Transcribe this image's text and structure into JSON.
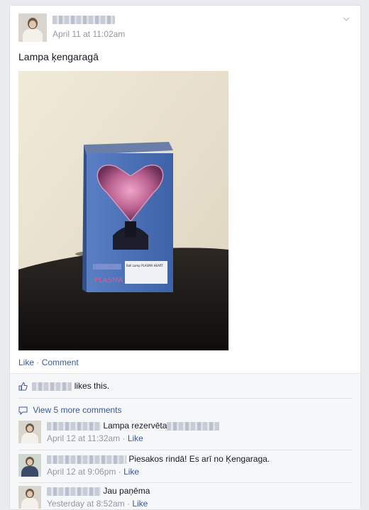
{
  "post": {
    "timestamp": "April 11 at 11:02am",
    "text": "Lampa ķengaragā",
    "photo": {
      "box_brand_text": "PLASMA",
      "box_label_text": "Ball Lamp PLASMA HEART",
      "box_color": "#4b6fb8"
    },
    "actions": {
      "like": "Like",
      "separator": " · ",
      "comment": "Comment"
    }
  },
  "likes": {
    "text": "likes this."
  },
  "comments_section": {
    "view_more": "View 5 more comments",
    "comments": [
      {
        "text": "Lampa rezervēta",
        "time": "April 12 at 11:32am",
        "sep": " · ",
        "like": "Like"
      },
      {
        "text": "Piesakos rindā! Es arī no Ķengaraga.",
        "time": "April 12 at 9:06pm",
        "sep": " · ",
        "like": "Like"
      },
      {
        "text": "Jau paņēma",
        "time": "Yesterday at 8:52am",
        "sep": " · ",
        "like": "Like"
      }
    ]
  },
  "colors": {
    "link": "#3b5998",
    "muted": "#9197a3",
    "text": "#141823",
    "background": "#e9ebee"
  },
  "icons": [
    "chevron-down-icon",
    "thumbs-up-icon",
    "comment-bubble-icon"
  ]
}
